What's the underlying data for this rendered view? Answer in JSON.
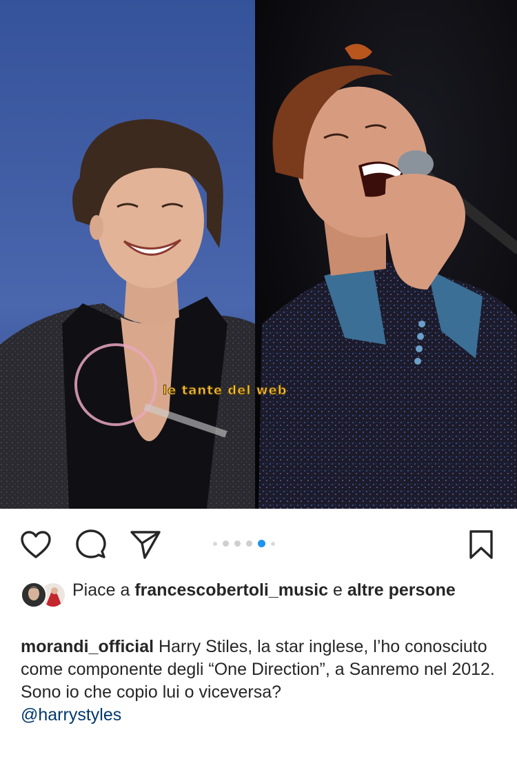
{
  "post": {
    "image": {
      "description_left": "smiling young man with curly hair in dark sparkly jacket, blue background",
      "description_right": "older man singing into microphone in sequined jacket, dark stage background",
      "watermark_right_text": "le tante del web"
    },
    "carousel": {
      "total": 5,
      "active_index": 3
    },
    "actions": {
      "like_icon": "heart-outline-icon",
      "comment_icon": "speech-bubble-icon",
      "share_icon": "paper-plane-icon",
      "save_icon": "bookmark-icon"
    },
    "likes": {
      "prefix": "Piace a",
      "user": "francescobertoli_music",
      "connector": "e",
      "others": "altre persone"
    },
    "caption": {
      "username": "morandi_official",
      "text_1": "Harry Stiles, la star inglese, l’ho conosciuto come componente degli “One Direction”, a Sanremo nel 2012.",
      "text_2": "Sono io che copio lui o viceversa?",
      "mention": "@harrystyles"
    }
  },
  "colors": {
    "text": "#262626",
    "link": "#00376b",
    "carousel_active": "#1d95f0",
    "left_bg": "#3f5a9c",
    "right_bg": "#0b0b0d"
  }
}
